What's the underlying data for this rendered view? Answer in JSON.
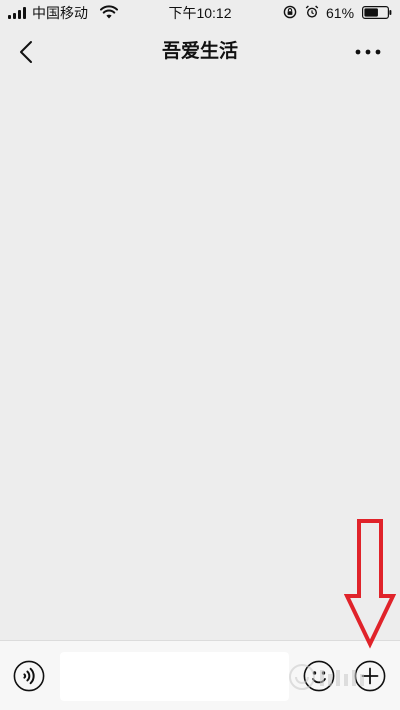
{
  "status_bar": {
    "carrier": "中国移动",
    "time": "下午10:12",
    "battery_percent": "61%",
    "battery_level": 0.61,
    "icons": [
      "signal-icon",
      "wifi-icon",
      "lock-rotation-icon",
      "alarm-icon",
      "battery-icon"
    ]
  },
  "nav_bar": {
    "title": "吾爱生活",
    "back_icon": "chevron-left-icon",
    "more_icon": "more-dots-icon"
  },
  "input_bar": {
    "input_value": "",
    "input_placeholder": "",
    "voice_icon": "voice-icon",
    "emoji_icon": "emoji-icon",
    "plus_icon": "plus-circle-icon"
  },
  "annotation": {
    "type": "red-down-arrow",
    "color": "#e0232a"
  },
  "watermark": {
    "text": "Baidu"
  },
  "colors": {
    "background": "#ededed",
    "input_bar": "#f7f7f7",
    "text": "#111111",
    "annotation": "#e0232a"
  }
}
